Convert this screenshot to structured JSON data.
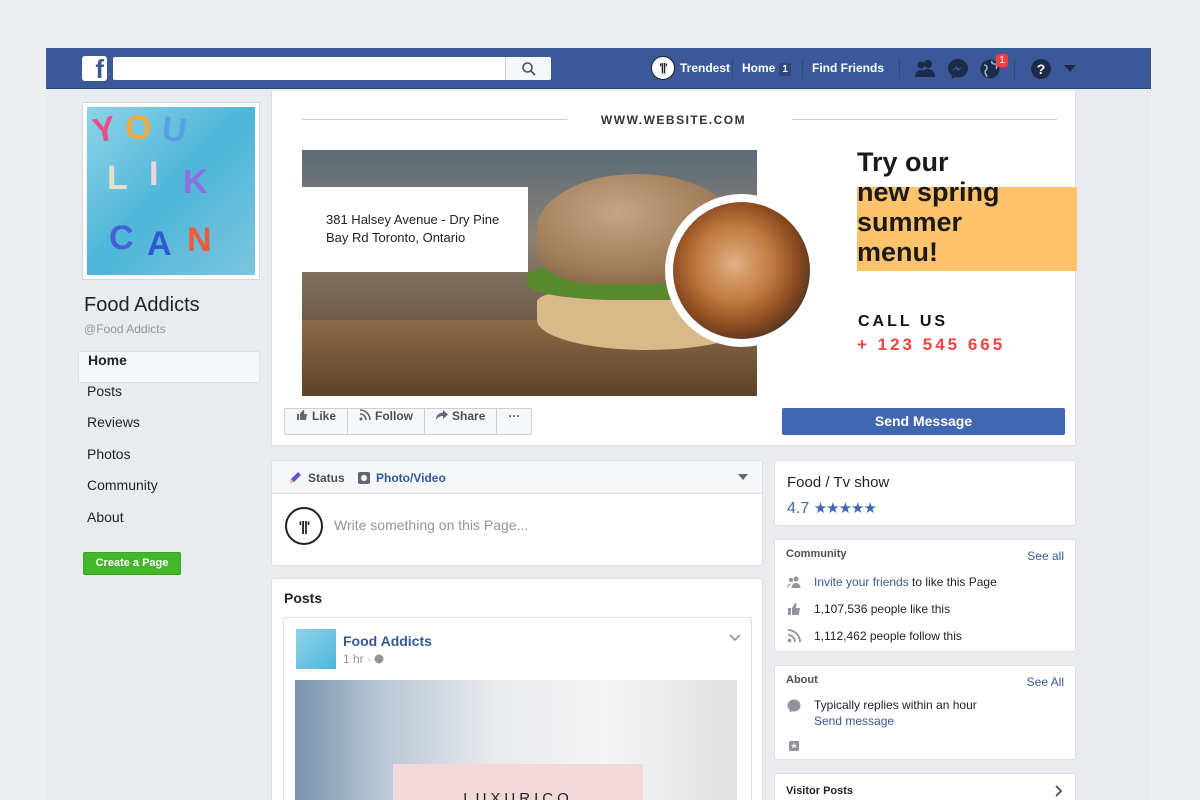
{
  "topbar": {
    "logo_letter": "f",
    "profile_initials": "'||'",
    "profile_name": "Trendest",
    "home_label": "Home",
    "home_count": "1",
    "find_friends": "Find Friends",
    "notification_count": "1"
  },
  "page": {
    "name": "Food Addicts",
    "handle": "Food Addicts"
  },
  "left_nav": {
    "items": [
      {
        "label": "Home"
      },
      {
        "label": "Posts"
      },
      {
        "label": "Reviews"
      },
      {
        "label": "Photos"
      },
      {
        "label": "Community"
      },
      {
        "label": "About"
      }
    ],
    "create_page": "Create a Page"
  },
  "cover": {
    "website": "WWW.WEBSITE.COM",
    "address_line1": "381 Halsey Avenue - Dry Pine",
    "address_line2": "Bay Rd Toronto, Ontario",
    "promo_line1": "Try our",
    "promo_line2": "new spring",
    "promo_line3": "summer",
    "promo_line4": "menu!",
    "call_label": "CALL US",
    "phone": "+ 123 545 665"
  },
  "actions": {
    "like": "Like",
    "follow": "Follow",
    "share": "Share",
    "more": "···",
    "send_message": "Send Message"
  },
  "composer": {
    "status_tab": "Status",
    "photo_tab": "Photo/Video",
    "placeholder": "Write something on this Page..."
  },
  "posts": {
    "title": "Posts",
    "author": "Food Addicts",
    "time": "1 hr ·",
    "image_text": "LUXURICO"
  },
  "category_card": {
    "category": "Food / Tv show",
    "rating": "4.7",
    "stars": "★★★★★"
  },
  "community_card": {
    "title": "Community",
    "see_all": "See all",
    "invite_link": "Invite your friends",
    "invite_rest": " to like this Page",
    "likes": "1,107,536 people like this",
    "follows": "1,112,462 people follow this"
  },
  "about_card": {
    "title": "About",
    "see_all": "See All",
    "replies": "Typically replies within an hour",
    "send_message": "Send message"
  },
  "visitor_card": {
    "title": "Visitor Posts"
  },
  "colors": {
    "fb_blue": "#3b5998",
    "button_blue": "#4267b2",
    "link_blue": "#365899",
    "promo_yellow": "#ffc36b",
    "phone_red": "#f0443f",
    "create_green": "#42b72a"
  }
}
